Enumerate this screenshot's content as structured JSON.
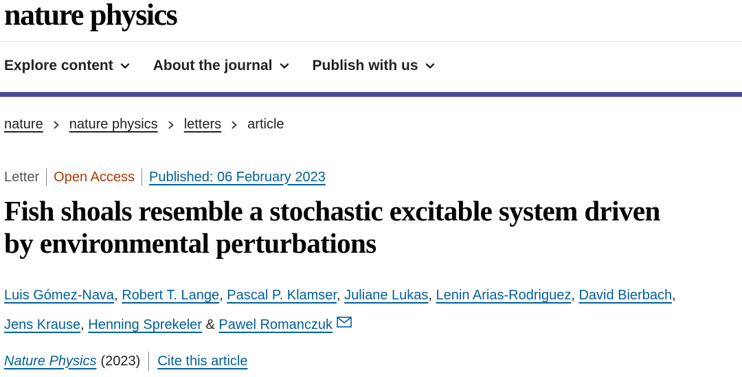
{
  "header": {
    "logo_part1": "nature",
    "logo_part2": "physics"
  },
  "nav": {
    "items": [
      {
        "label": "Explore content",
        "icon": "chevron-down-icon"
      },
      {
        "label": "About the journal",
        "icon": "chevron-down-icon"
      },
      {
        "label": "Publish with us",
        "icon": "chevron-down-icon"
      }
    ],
    "accent_color": "#4b4b9a"
  },
  "breadcrumb": {
    "items": [
      "nature",
      "nature physics",
      "letters"
    ],
    "current": "article"
  },
  "article": {
    "type": "Letter",
    "access": "Open Access",
    "published": "Published: 06 February 2023",
    "title": "Fish shoals resemble a stochastic excitable system driven by environmental perturbations",
    "authors": [
      "Luis Gómez-Nava",
      "Robert T. Lange",
      "Pascal P. Klamser",
      "Juliane Lukas",
      "Lenin Arias-Rodriguez",
      "David Bierbach",
      "Jens Krause",
      "Henning Sprekeler",
      "Pawel Romanczuk"
    ],
    "comma": ",",
    "ampersand": "&",
    "contact_icon": "mail-icon",
    "journal": "Nature Physics",
    "year": "(2023)",
    "cite_label": "Cite this article",
    "link_color": "#00609c",
    "open_access_color": "#b33a00"
  }
}
